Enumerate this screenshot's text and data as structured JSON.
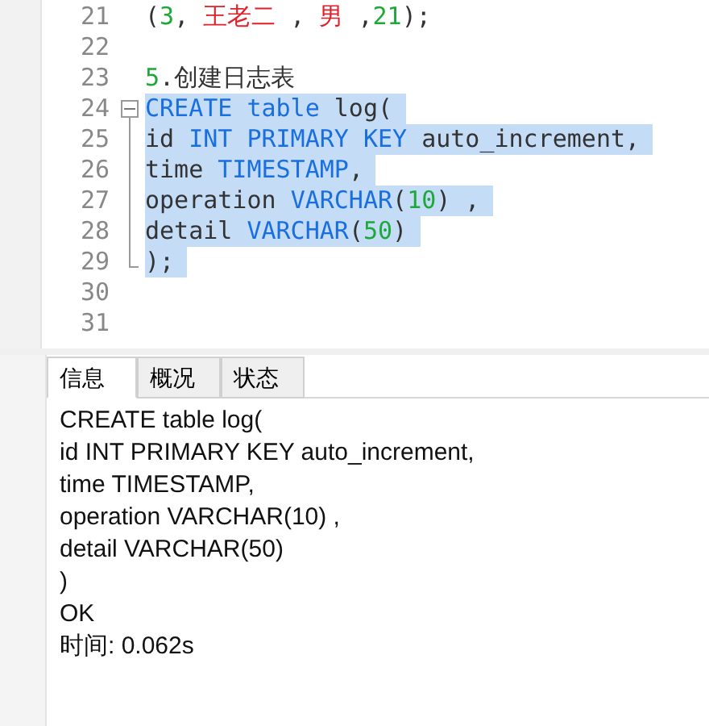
{
  "editor": {
    "lines": [
      {
        "number": "21",
        "selected": false,
        "kind": "plain",
        "tokens": [
          {
            "text": "(",
            "kind": "plain"
          },
          {
            "text": "3",
            "kind": "number"
          },
          {
            "text": ", ",
            "kind": "plain"
          },
          {
            "text": "王老二",
            "kind": "string"
          },
          {
            "text": " , ",
            "kind": "plain"
          },
          {
            "text": "男",
            "kind": "string"
          },
          {
            "text": " ,",
            "kind": "plain"
          },
          {
            "text": "21",
            "kind": "number"
          },
          {
            "text": ");",
            "kind": "plain"
          }
        ]
      },
      {
        "number": "22",
        "selected": false,
        "kind": "plain"
      },
      {
        "number": "23",
        "selected": false,
        "kind": "plain",
        "tokens": [
          {
            "text": "5",
            "kind": "number"
          },
          {
            "text": ".创建日志表",
            "kind": "plain"
          }
        ]
      },
      {
        "number": "24",
        "selected": true,
        "kind": "fold-start",
        "tokens": [
          {
            "text": "CREATE table",
            "kind": "keyword"
          },
          {
            "text": " log(",
            "kind": "plain"
          }
        ]
      },
      {
        "number": "25",
        "selected": true,
        "kind": "fold-line",
        "tokens": [
          {
            "text": "id ",
            "kind": "plain"
          },
          {
            "text": "INT PRIMARY KEY",
            "kind": "keyword"
          },
          {
            "text": " auto_increment,",
            "kind": "plain"
          }
        ]
      },
      {
        "number": "26",
        "selected": true,
        "kind": "fold-line",
        "tokens": [
          {
            "text": "time ",
            "kind": "plain"
          },
          {
            "text": "TIMESTAMP",
            "kind": "keyword"
          },
          {
            "text": ",",
            "kind": "plain"
          }
        ]
      },
      {
        "number": "27",
        "selected": true,
        "kind": "fold-line",
        "tokens": [
          {
            "text": "operation ",
            "kind": "plain"
          },
          {
            "text": "VARCHAR",
            "kind": "keyword"
          },
          {
            "text": "(",
            "kind": "plain"
          },
          {
            "text": "10",
            "kind": "number"
          },
          {
            "text": ") ,",
            "kind": "plain"
          }
        ]
      },
      {
        "number": "28",
        "selected": true,
        "kind": "fold-line",
        "tokens": [
          {
            "text": "detail ",
            "kind": "plain"
          },
          {
            "text": "VARCHAR",
            "kind": "keyword"
          },
          {
            "text": "(",
            "kind": "plain"
          },
          {
            "text": "50",
            "kind": "number"
          },
          {
            "text": ")",
            "kind": "plain"
          }
        ]
      },
      {
        "number": "29",
        "selected": true,
        "kind": "fold-end",
        "tokens": [
          {
            "text": ");",
            "kind": "plain"
          }
        ]
      },
      {
        "number": "30",
        "selected": false,
        "kind": "plain"
      },
      {
        "number": "31",
        "selected": false,
        "kind": "plain"
      }
    ]
  },
  "tabs": [
    {
      "label": "信息",
      "selected": true
    },
    {
      "label": "概况",
      "selected": false
    },
    {
      "label": "状态",
      "selected": false
    }
  ],
  "output": {
    "lines": [
      "CREATE table log(",
      "id INT PRIMARY KEY auto_increment,",
      "time TIMESTAMP,",
      "operation VARCHAR(10) ,",
      "detail VARCHAR(50)",
      ")",
      "OK",
      "时间: 0.062s"
    ]
  }
}
